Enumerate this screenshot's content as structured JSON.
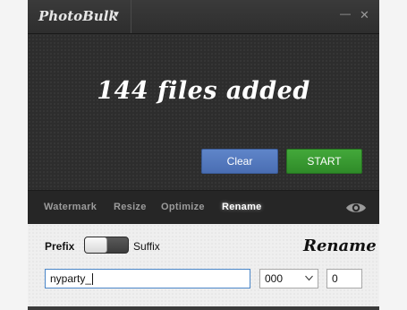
{
  "titlebar": {
    "app_name": "PhotoBulk",
    "menu_caret": "▼",
    "minimize_glyph": "—",
    "close_glyph": "✕"
  },
  "main": {
    "status": "144 files added",
    "clear_label": "Clear",
    "start_label": "START"
  },
  "tabs": [
    {
      "label": "Watermark",
      "active": false
    },
    {
      "label": "Resize",
      "active": false
    },
    {
      "label": "Optimize",
      "active": false
    },
    {
      "label": "Rename",
      "active": true
    }
  ],
  "rename_panel": {
    "title": "Rename",
    "prefix_label": "Prefix",
    "suffix_label": "Suffix",
    "toggle_state": "prefix",
    "prefix_value": "nyparty_",
    "digits_value": "000",
    "start_value": "0"
  },
  "icons": {
    "preview": "eye-icon",
    "digits_dropdown": "chevron-down-icon"
  },
  "colors": {
    "clear_button": "#5677bd",
    "start_button": "#38992f",
    "input_focus": "#4a86c8"
  }
}
